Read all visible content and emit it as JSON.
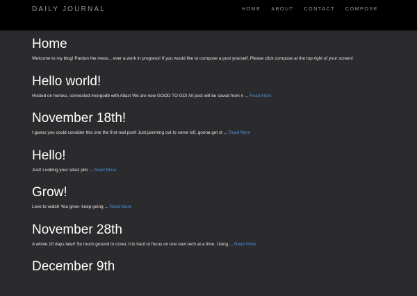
{
  "navbar": {
    "brand": "DAILY JOURNAL",
    "links": [
      "HOME",
      "ABOUT",
      "CONTACT",
      "COMPOSE"
    ]
  },
  "home": {
    "title": "Home",
    "text": "Welcome to my blog! Pardon the mess... ever a work in progress! If you would like to compose a post yourself. Please click compose at the top right of your screen!"
  },
  "posts": [
    {
      "title": "Hello world!",
      "text": "Hosted on heroku, connected mongodb with Atlas! We are now GOOD TO GO! All post will be saved from n ...",
      "link": "Read More"
    },
    {
      "title": "November 18th!",
      "text": "I guess you could consider this one the first real post! Just jamming out to some lofi, gonna get st ...",
      "link": "Read More"
    },
    {
      "title": "Hello!",
      "text": "Just! Looking your sites! j4m ...",
      "link": "Read More"
    },
    {
      "title": "Grow!",
      "text": "Love to watch You grow- keep going ...",
      "link": "Read More"
    },
    {
      "title": "November 28th",
      "text": "A whole 10 days later! So much ground to cover, it is hard to focus on one new tech at a time. Using ...",
      "link": "Read More"
    },
    {
      "title": "December 9th",
      "text": "",
      "link": ""
    }
  ],
  "colors": {
    "background": "#2b2b2e",
    "navbar": "#000000",
    "link": "#4a90d9"
  }
}
